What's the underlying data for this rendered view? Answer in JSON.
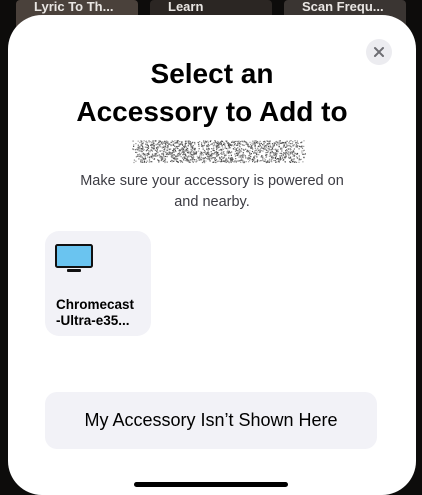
{
  "background": {
    "tiles": [
      "Lyric To Th...",
      "Learn",
      "Scan Frequ..."
    ]
  },
  "dialog": {
    "title_line1": "Select an",
    "title_line2": "Accessory to Add to",
    "subtitle_line1": "Make sure your accessory is powered on",
    "subtitle_line2": "and nearby.",
    "close_icon": "close-icon"
  },
  "accessories": [
    {
      "name_line1": "Chromecast",
      "name_line2": "-Ultra-e35...",
      "icon": "tv-icon",
      "icon_color": "#6ac4f0"
    }
  ],
  "not_shown_button": {
    "label": "My Accessory Isn’t Shown Here"
  },
  "colors": {
    "sheet": "#ffffff",
    "tile": "#f2f2f7",
    "accent_icon": "#6ac4f0"
  }
}
